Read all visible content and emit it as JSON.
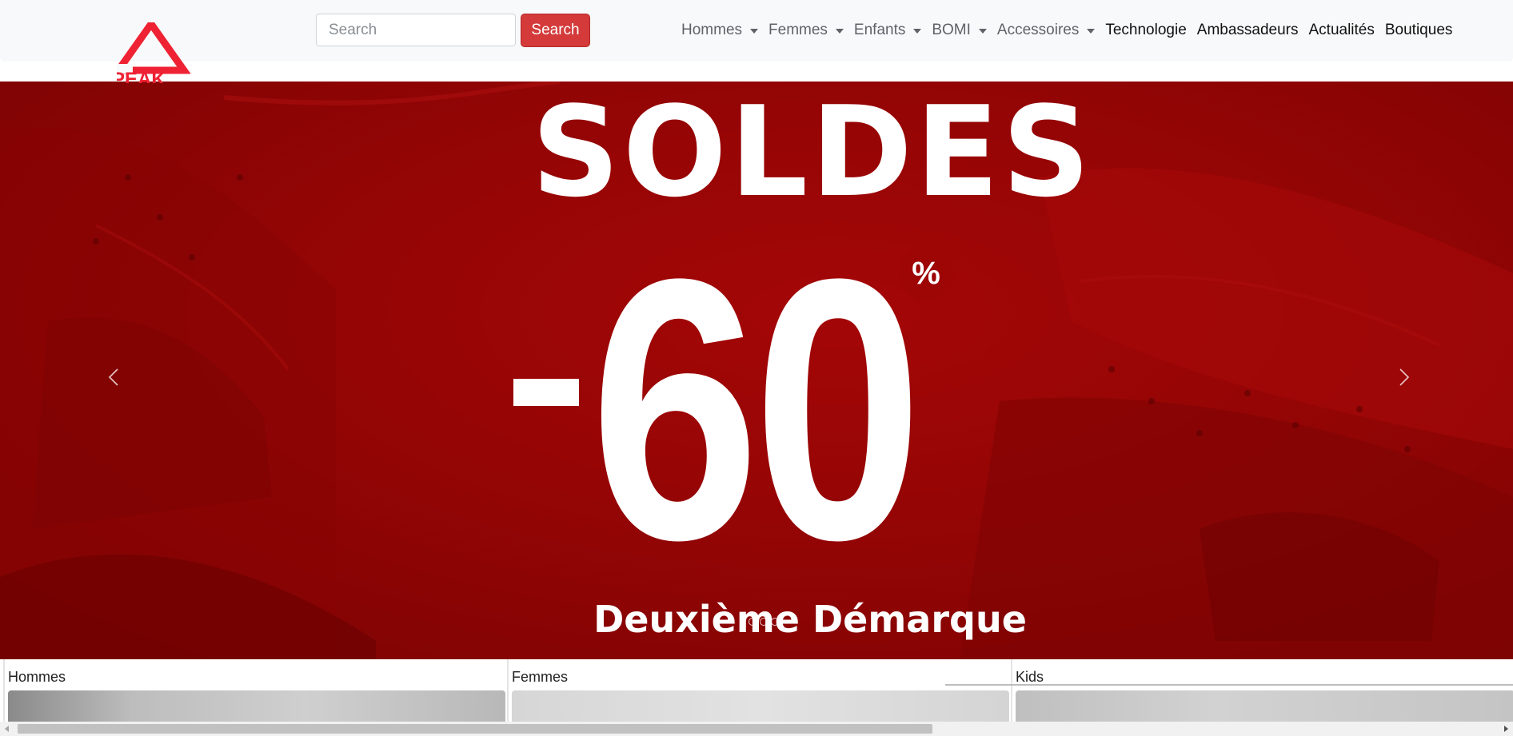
{
  "brand": {
    "name": "PEAK",
    "accent": "#ee2233"
  },
  "search": {
    "placeholder": "Search",
    "button_label": "Search"
  },
  "nav": {
    "items": [
      {
        "label": "Hommes",
        "dropdown": true
      },
      {
        "label": "Femmes",
        "dropdown": true
      },
      {
        "label": "Enfants",
        "dropdown": true
      },
      {
        "label": "BOMI",
        "dropdown": true
      },
      {
        "label": "Accessoires",
        "dropdown": true
      },
      {
        "label": "Technologie",
        "dropdown": false
      },
      {
        "label": "Ambassadeurs",
        "dropdown": false
      },
      {
        "label": "Actualités",
        "dropdown": false
      },
      {
        "label": "Boutiques",
        "dropdown": false
      }
    ]
  },
  "hero": {
    "title": "SOLDES",
    "discount_digits": "60",
    "percent": "%",
    "subtitle": "Deuxième Démarque",
    "background": "#9a0505",
    "slides": 3,
    "active_slide": 1
  },
  "categories": [
    {
      "label": "Hommes"
    },
    {
      "label": "Femmes"
    },
    {
      "label": "Kids"
    }
  ]
}
